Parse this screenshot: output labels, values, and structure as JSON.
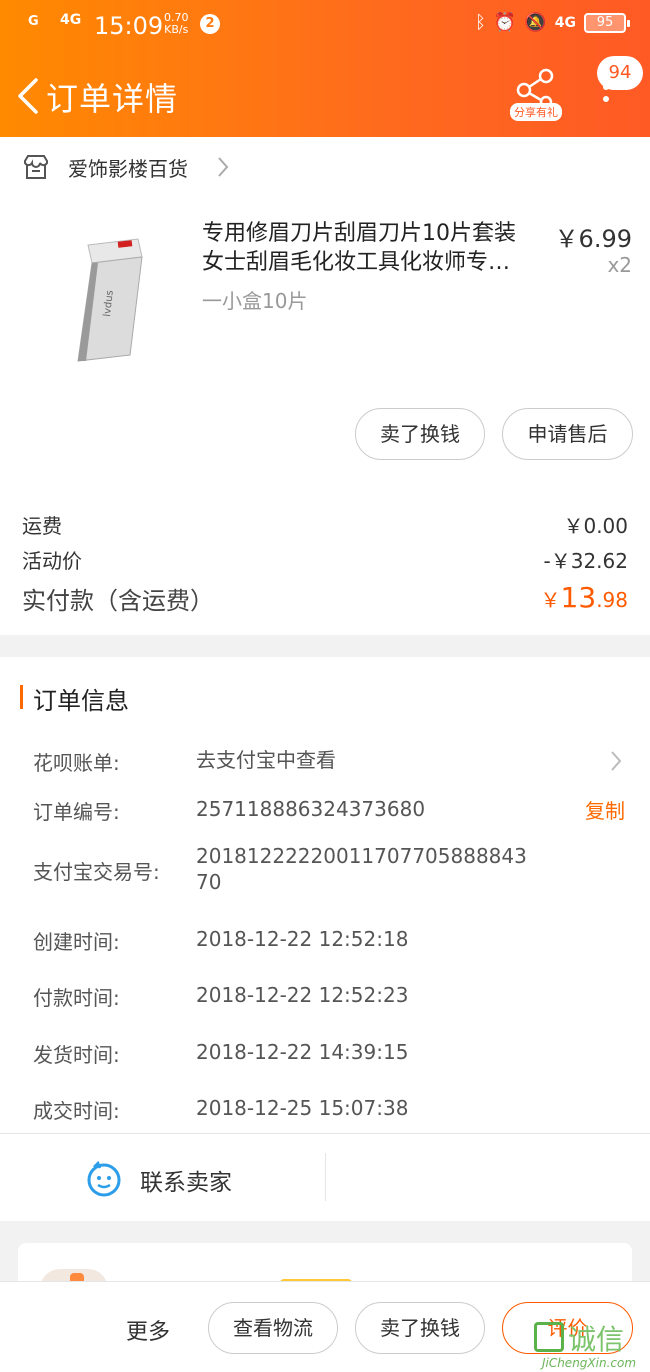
{
  "status_bar": {
    "signal": "G",
    "network": "4G",
    "time": "15:09",
    "speed_value": "0.70",
    "speed_unit": "KB/s",
    "notif_count": "2",
    "right_network": "4G",
    "battery": "95"
  },
  "header": {
    "title": "订单详情",
    "share_label": "分享有礼",
    "message_count": "94"
  },
  "shop": {
    "name": "爱饰影楼百货"
  },
  "product": {
    "title": "专用修眉刀片刮眉刀片10片套装女士刮眉毛化妆工具化妆师专…",
    "sku": "一小盒10片",
    "price": "￥6.99",
    "qty": "x2",
    "btn_sell": "卖了换钱",
    "btn_after_sale": "申请售后"
  },
  "costs": {
    "shipping_label": "运费",
    "shipping_value": "￥0.00",
    "promo_label": "活动价",
    "promo_value": "-￥32.62",
    "total_label": "实付款（含运费）",
    "total_currency": "￥",
    "total_int": "13",
    "total_dec": ".98"
  },
  "order_info": {
    "section_title": "订单信息",
    "huabei_label": "花呗账单:",
    "huabei_value": "去支付宝中查看",
    "order_no_label": "订单编号:",
    "order_no_value": "257118886324373680",
    "copy_label": "复制",
    "alipay_label": "支付宝交易号:",
    "alipay_value": "20181222220011707705888843 70",
    "created_label": "创建时间:",
    "created_value": "2018-12-22 12:52:18",
    "paid_label": "付款时间:",
    "paid_value": "2018-12-22 12:52:23",
    "shipped_label": "发货时间:",
    "shipped_value": "2018-12-22 14:39:15",
    "completed_label": "成交时间:",
    "completed_value": "2018-12-25 15:07:38",
    "contact_label": "联系卖家"
  },
  "bottom_bar": {
    "more": "更多",
    "logistics": "查看物流",
    "sell": "卖了换钱",
    "rate": "评价"
  },
  "watermark": {
    "text": "诚信",
    "url": "JiChengXin.com"
  },
  "colors": {
    "accent": "#ff6a00",
    "header_start": "#ff8a00",
    "header_end": "#ff5a24"
  }
}
